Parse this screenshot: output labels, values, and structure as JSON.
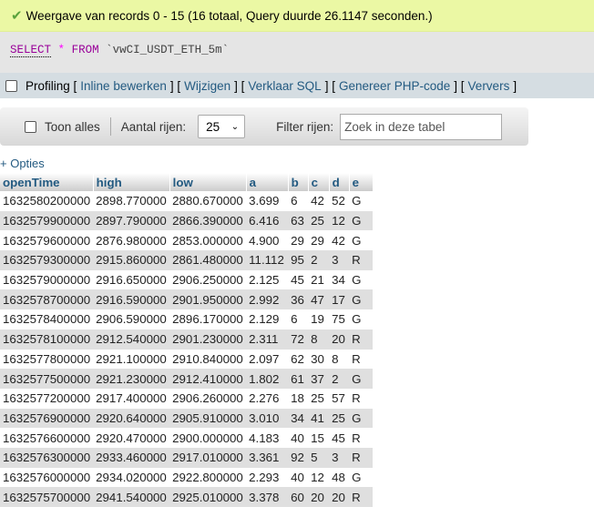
{
  "success": {
    "icon": "check-icon",
    "message": "Weergave van records 0 - 15 (16 totaal, Query duurde 26.1147 seconden.)"
  },
  "sql": {
    "select": "SELECT",
    "star": "*",
    "from": "FROM",
    "table": "`vwCI_USDT_ETH_5m`"
  },
  "profiling": {
    "label": "Profiling",
    "links": [
      "Inline bewerken",
      "Wijzigen",
      "Verklaar SQL",
      "Genereer PHP-code",
      "Ververs"
    ]
  },
  "nav": {
    "show_all": "Toon alles",
    "rows_label": "Aantal rijen:",
    "rows_value": "25",
    "filter_label": "Filter rijen:",
    "filter_placeholder": "Zoek in deze tabel"
  },
  "options": "+ Opties",
  "table": {
    "columns": [
      "openTime",
      "high",
      "low",
      "a",
      "b",
      "c",
      "d",
      "e"
    ],
    "rows": [
      [
        "1632580200000",
        "2898.770000",
        "2880.670000",
        "3.699",
        "6",
        "42",
        "52",
        "G"
      ],
      [
        "1632579900000",
        "2897.790000",
        "2866.390000",
        "6.416",
        "63",
        "25",
        "12",
        "G"
      ],
      [
        "1632579600000",
        "2876.980000",
        "2853.000000",
        "4.900",
        "29",
        "29",
        "42",
        "G"
      ],
      [
        "1632579300000",
        "2915.860000",
        "2861.480000",
        "11.112",
        "95",
        "2",
        "3",
        "R"
      ],
      [
        "1632579000000",
        "2916.650000",
        "2906.250000",
        "2.125",
        "45",
        "21",
        "34",
        "G"
      ],
      [
        "1632578700000",
        "2916.590000",
        "2901.950000",
        "2.992",
        "36",
        "47",
        "17",
        "G"
      ],
      [
        "1632578400000",
        "2906.590000",
        "2896.170000",
        "2.129",
        "6",
        "19",
        "75",
        "G"
      ],
      [
        "1632578100000",
        "2912.540000",
        "2901.230000",
        "2.311",
        "72",
        "8",
        "20",
        "R"
      ],
      [
        "1632577800000",
        "2921.100000",
        "2910.840000",
        "2.097",
        "62",
        "30",
        "8",
        "R"
      ],
      [
        "1632577500000",
        "2921.230000",
        "2912.410000",
        "1.802",
        "61",
        "37",
        "2",
        "G"
      ],
      [
        "1632577200000",
        "2917.400000",
        "2906.260000",
        "2.276",
        "18",
        "25",
        "57",
        "R"
      ],
      [
        "1632576900000",
        "2920.640000",
        "2905.910000",
        "3.010",
        "34",
        "41",
        "25",
        "G"
      ],
      [
        "1632576600000",
        "2920.470000",
        "2900.000000",
        "4.183",
        "40",
        "15",
        "45",
        "R"
      ],
      [
        "1632576300000",
        "2933.460000",
        "2917.010000",
        "3.361",
        "92",
        "5",
        "3",
        "R"
      ],
      [
        "1632576000000",
        "2934.020000",
        "2922.800000",
        "2.293",
        "40",
        "12",
        "48",
        "G"
      ],
      [
        "1632575700000",
        "2941.540000",
        "2925.010000",
        "3.378",
        "60",
        "20",
        "20",
        "R"
      ]
    ]
  }
}
